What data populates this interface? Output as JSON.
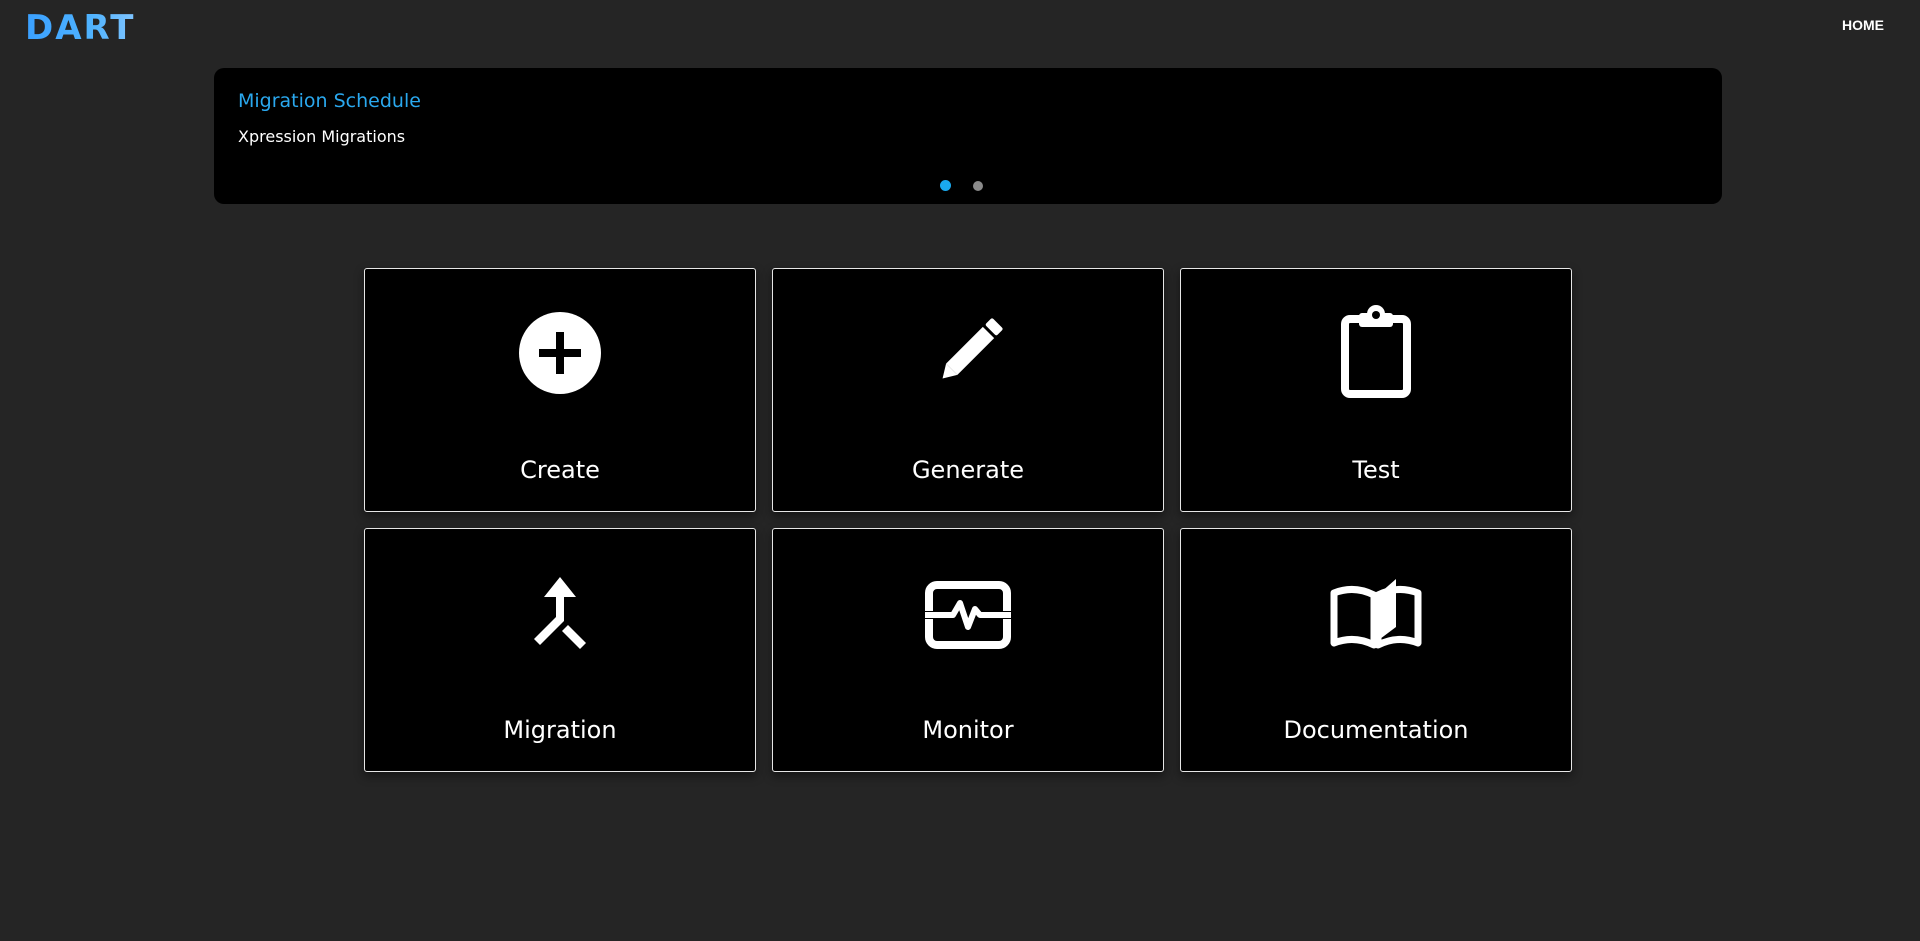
{
  "header": {
    "logo_text": "DART",
    "nav_home": "HOME"
  },
  "carousel": {
    "title": "Migration Schedule",
    "subtitle": "Xpression Migrations",
    "slide_count": 2,
    "active_slide": 1
  },
  "tiles": [
    {
      "label": "Create",
      "icon": "plus-circle-icon"
    },
    {
      "label": "Generate",
      "icon": "pencil-icon"
    },
    {
      "label": "Test",
      "icon": "clipboard-icon"
    },
    {
      "label": "Migration",
      "icon": "merge-arrow-icon"
    },
    {
      "label": "Monitor",
      "icon": "activity-monitor-icon"
    },
    {
      "label": "Documentation",
      "icon": "open-book-icon"
    }
  ],
  "colors": {
    "background": "#252525",
    "panel": "#000000",
    "accent": "#2aa8ee",
    "text": "#ffffff"
  }
}
